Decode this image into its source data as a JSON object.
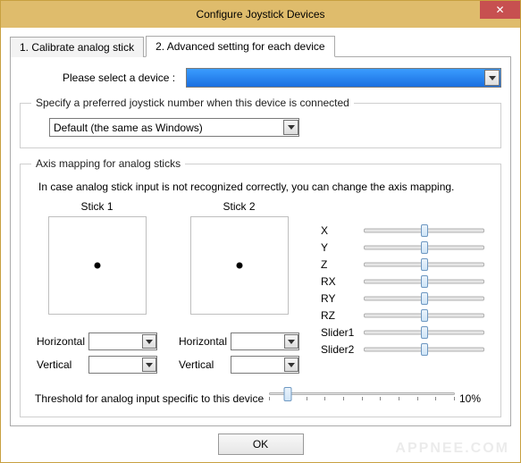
{
  "window": {
    "title": "Configure Joystick Devices",
    "close_icon": "✕"
  },
  "tabs": {
    "calibrate": "1. Calibrate analog stick",
    "advanced": "2. Advanced setting for each device"
  },
  "device": {
    "label": "Please select a device :",
    "selected": ""
  },
  "preferred": {
    "legend": "Specify a preferred joystick number when this device is connected",
    "selected": "Default (the same as Windows)"
  },
  "axis": {
    "legend": "Axis mapping for analog sticks",
    "info": "In case analog stick input is not recognized correctly, you can change the axis mapping.",
    "stick1": {
      "title": "Stick 1",
      "horizontal_label": "Horizontal",
      "vertical_label": "Vertical",
      "horizontal_value": "",
      "vertical_value": ""
    },
    "stick2": {
      "title": "Stick 2",
      "horizontal_label": "Horizontal",
      "vertical_label": "Vertical",
      "horizontal_value": "",
      "vertical_value": ""
    },
    "sliders": [
      "X",
      "Y",
      "Z",
      "RX",
      "RY",
      "RZ",
      "Slider1",
      "Slider2"
    ],
    "threshold": {
      "label": "Threshold for analog input specific to this device",
      "value_text": "10%",
      "value_pct": 10
    }
  },
  "buttons": {
    "ok": "OK"
  },
  "watermark": "APPNEE.COM"
}
